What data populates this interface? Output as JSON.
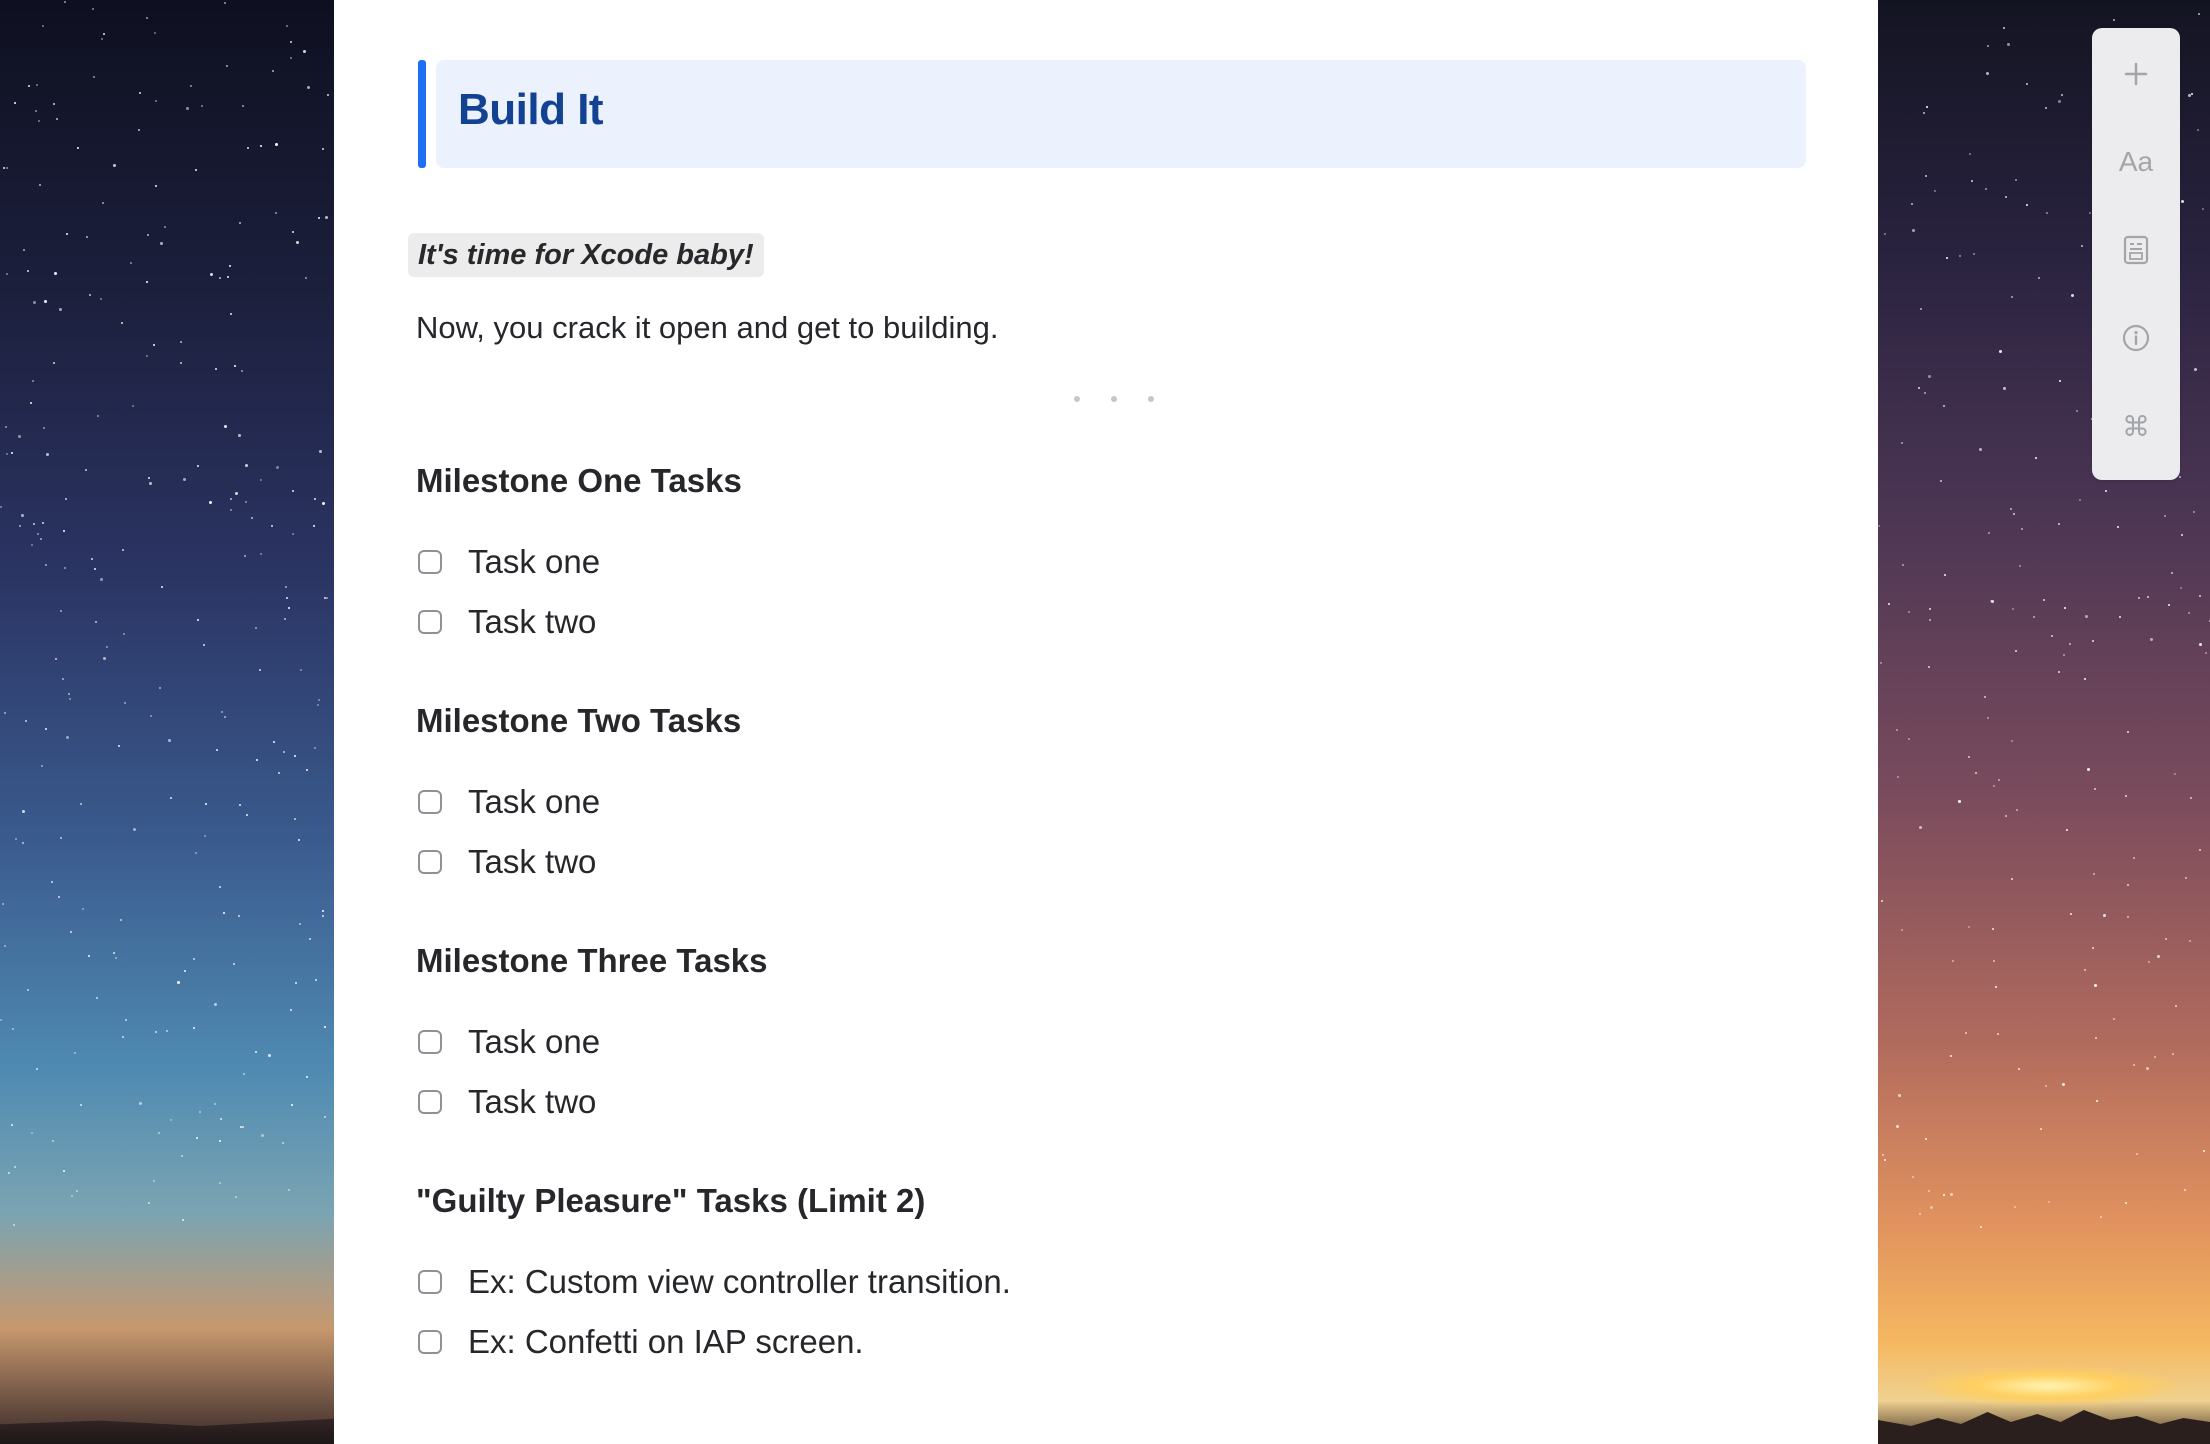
{
  "document": {
    "title": "Build It",
    "callout": "It's time for Xcode baby!",
    "intro": "Now, you crack it open and get to building.",
    "sections": [
      {
        "heading": "Milestone One Tasks",
        "tasks": [
          {
            "label": "Task one",
            "checked": false
          },
          {
            "label": "Task two",
            "checked": false
          }
        ]
      },
      {
        "heading": "Milestone Two Tasks",
        "tasks": [
          {
            "label": "Task one",
            "checked": false
          },
          {
            "label": "Task two",
            "checked": false
          }
        ]
      },
      {
        "heading": "Milestone Three Tasks",
        "tasks": [
          {
            "label": "Task one",
            "checked": false
          },
          {
            "label": "Task two",
            "checked": false
          }
        ]
      },
      {
        "heading": "\"Guilty Pleasure\" Tasks (Limit 2)",
        "tasks": [
          {
            "label": "Ex: Custom view controller transition.",
            "checked": false
          },
          {
            "label": "Ex: Confetti on IAP screen.",
            "checked": false
          }
        ]
      }
    ]
  },
  "toolbar": {
    "items": [
      {
        "icon": "plus-icon"
      },
      {
        "icon": "text-format-icon",
        "text": "Aa"
      },
      {
        "icon": "media-card-icon"
      },
      {
        "icon": "info-icon"
      },
      {
        "icon": "command-icon",
        "text": "⌘"
      }
    ]
  },
  "colors": {
    "accent": "#1f6ff2",
    "title_text": "#144292",
    "title_background": "#ebf1fd",
    "body_text": "#25272a",
    "toolbar_background": "#ececee",
    "toolbar_icon": "#a3a5a9"
  }
}
